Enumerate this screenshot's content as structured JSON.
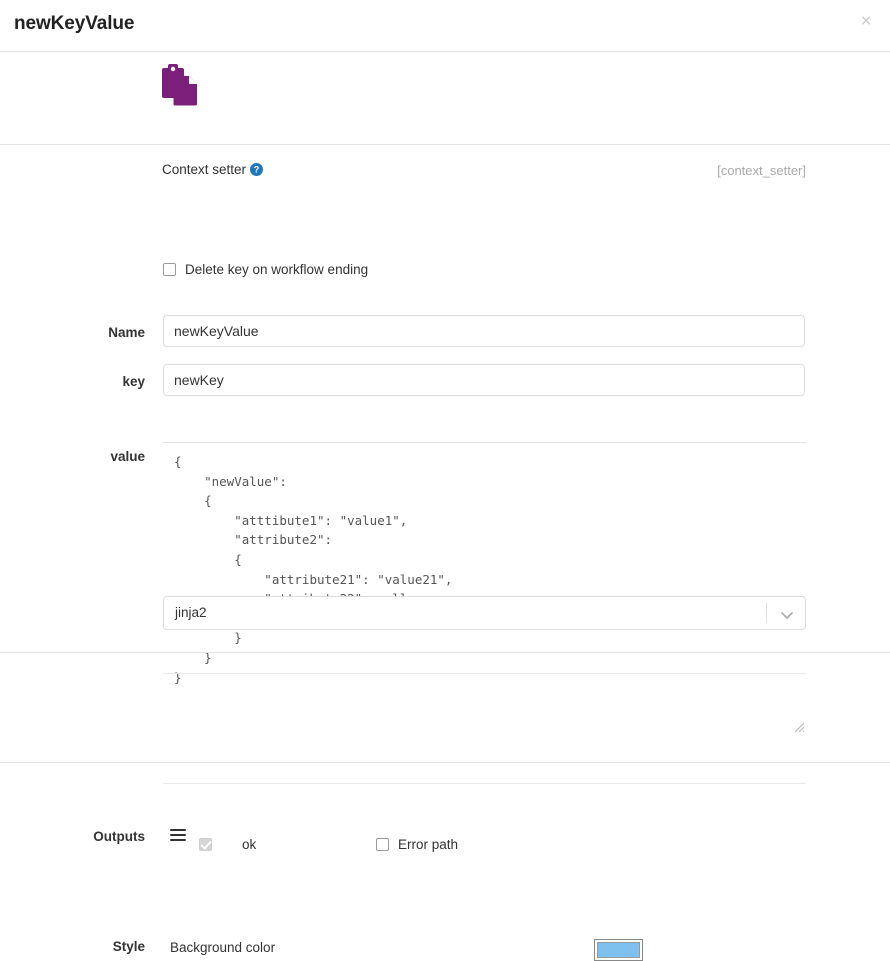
{
  "header": {
    "title": "newKeyValue",
    "close_label": "×"
  },
  "node": {
    "icon_name": "clipboard-copy-icon",
    "icon_color": "#7B1F7B",
    "label": "Context setter",
    "help_icon_name": "help-circle-icon",
    "help_icon_color": "#2277BB",
    "type_tag": "[context_setter]"
  },
  "fields": {
    "name": {
      "label": "Name",
      "value": "newKeyValue",
      "placeholder": ""
    },
    "key": {
      "label": "key",
      "value": "newKey",
      "placeholder": ""
    },
    "delete_key": {
      "label": "Delete key on workflow ending",
      "checked": false
    },
    "value": {
      "label": "value",
      "text": "{\n    \"newValue\":\n    {\n        \"atttibute1\": \"value1\",\n        \"attribute2\":\n        {\n            \"attribute21\": \"value21\",\n            \"attribute22\": null,\n            \"attribute23\": true\n        }\n    }\n}",
      "placeholder": ""
    },
    "template_engine": {
      "selected": "jinja2",
      "options": [
        "jinja2"
      ]
    }
  },
  "outputs": {
    "label": "Outputs",
    "rows": [
      {
        "handle_name": "drag-handle",
        "checkbox_checked": true,
        "checkbox_disabled": true,
        "name": "ok"
      }
    ],
    "error_path": {
      "label": "Error path",
      "checked": false
    }
  },
  "style": {
    "label": "Style",
    "background_color_label": "Background color",
    "background_color": "#7EC0EE"
  }
}
